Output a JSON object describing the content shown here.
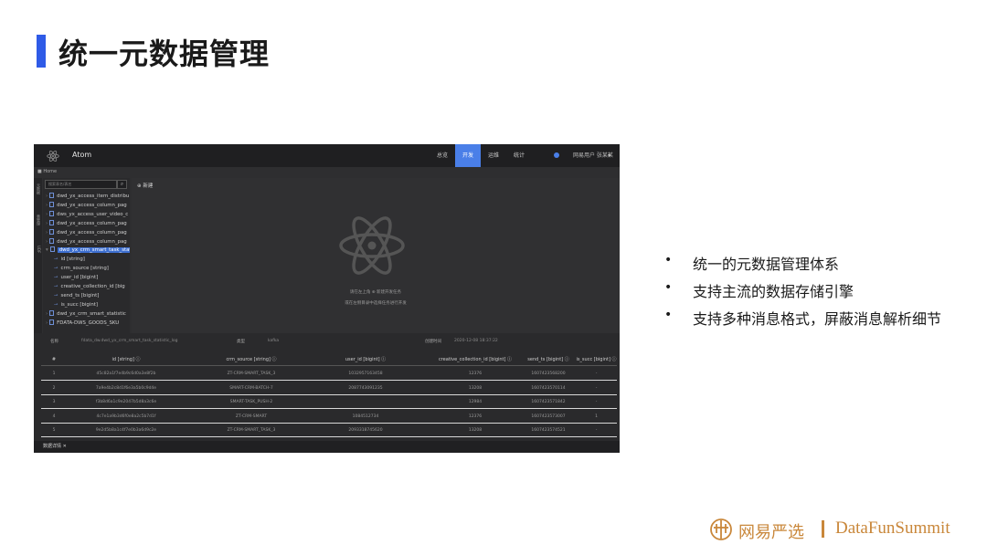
{
  "slide": {
    "title": "统一元数据管理",
    "bullets": [
      "统一的元数据管理体系",
      "支持主流的数据存储引擎",
      "支持多种消息格式，屏蔽消息解析细节"
    ],
    "footer_brand": "网易严选",
    "footer_partner": "DataFunSummit",
    "accent_color": "#2f5be7",
    "footer_color": "#c9873a"
  },
  "app": {
    "name": "Atom",
    "nav": [
      {
        "label": "总览",
        "active": false
      },
      {
        "label": "开发",
        "active": true
      },
      {
        "label": "运维",
        "active": false
      },
      {
        "label": "统计",
        "active": false
      }
    ],
    "user": "网易用户 张某某",
    "user_caret": "▾",
    "breadcrumb": "■ Home",
    "left_strip": [
      "元数据",
      "表管理",
      "UDF"
    ],
    "search_placeholder": "搜索表名/表名",
    "search_icon": "search-icon",
    "tree": [
      {
        "label": "dwd_yx_access_item_distribu",
        "kind": "table",
        "selected": false
      },
      {
        "label": "dwd_yx_access_column_pag",
        "kind": "table",
        "selected": false
      },
      {
        "label": "dws_yx_access_user_video_c",
        "kind": "table",
        "selected": false
      },
      {
        "label": "dwd_yx_access_column_pag",
        "kind": "table",
        "selected": false
      },
      {
        "label": "dwd_yx_access_column_pag",
        "kind": "table",
        "selected": false
      },
      {
        "label": "dwd_yx_access_column_pag",
        "kind": "table",
        "selected": false
      },
      {
        "label": "dwd_yx_crm_smart_task_stat",
        "kind": "table",
        "selected": true
      },
      {
        "label": "id [string]",
        "kind": "field",
        "selected": false
      },
      {
        "label": "crm_source [string]",
        "kind": "field",
        "selected": false
      },
      {
        "label": "user_id [bigint]",
        "kind": "field",
        "selected": false
      },
      {
        "label": "creative_collection_id [big",
        "kind": "field",
        "selected": false
      },
      {
        "label": "send_ts [bigint]",
        "kind": "field",
        "selected": false
      },
      {
        "label": "is_succ [bigint]",
        "kind": "field",
        "selected": false
      },
      {
        "label": "dwd_yx_crm_smart_statistic",
        "kind": "table",
        "selected": false
      },
      {
        "label": "FDATA-DWS_GOODS_SKU",
        "kind": "table",
        "selected": false
      }
    ],
    "new_label": "新建",
    "empty_line1": "请在左上角 ⊕ 新建开发任务",
    "empty_line2": "或在左侧目录中选择任务进行开发",
    "meta": {
      "name_label": "名称",
      "name_value": "fdata_dw.dwd_yx_crm_smart_task_statistic_log",
      "type_label": "类型",
      "type_value": "kafka",
      "created_label": "创建时间",
      "created_value": "2020-12-08 18:37:22"
    },
    "table": {
      "columns": [
        "#",
        "id [string] ⓘ",
        "crm_source [string] ⓘ",
        "user_id [bigint] ⓘ",
        "creative_collection_id [bigint] ⓘ",
        "send_ts [bigint] ⓘ",
        "is_succ [bigint] ⓘ"
      ],
      "rows": [
        [
          "1",
          "d5c82a1f7e4b9c6d0a3e8f2b",
          "ZT-CRM-SMART_TASK_3",
          "1032957163458",
          "12376",
          "1607423568200",
          "-"
        ],
        [
          "2",
          "7a9e4b2c8d1f6e3a5b0c9d4e",
          "SMART-CRM-BATCH-7",
          "2087743091235",
          "13208",
          "1607423570114",
          "-"
        ],
        [
          "3",
          "f3b8d6a1c9e2047b5d8a3c6e",
          "SMART-TASK_PUSH-2",
          "",
          "12984",
          "1607423571842",
          "-"
        ],
        [
          "4",
          "4c7e1a9b3d6f0e8a2c5b7d1f",
          "ZT-CRM-SMART",
          "1084512734",
          "12376",
          "1607423573007",
          "1"
        ],
        [
          "5",
          "9e2d5b8a1c4f7e0b3a6d9c2e",
          "ZT-CRM-SMART_TASK_3",
          "2093318745620",
          "13208",
          "1607423574521",
          "-"
        ]
      ]
    },
    "bottom_tab": "数据详情 ✕"
  }
}
